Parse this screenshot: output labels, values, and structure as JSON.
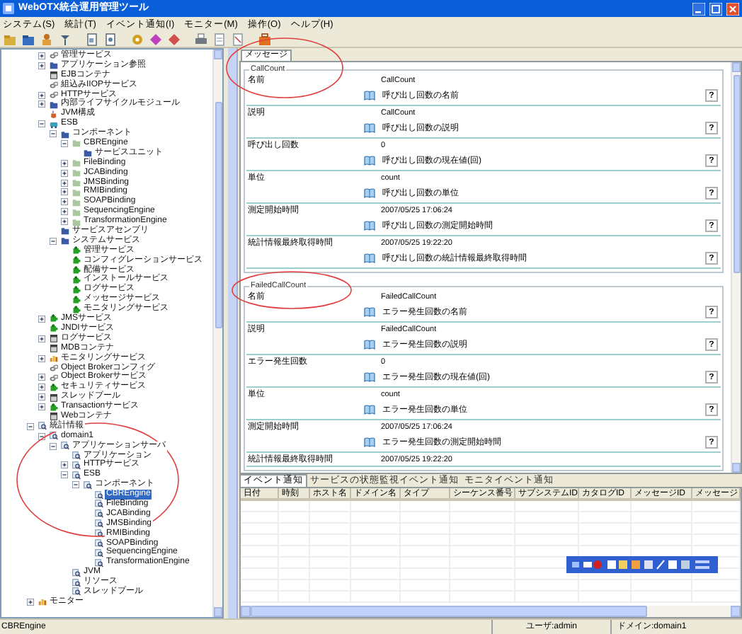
{
  "window": {
    "title": "WebOTX統合運用管理ツール"
  },
  "menu": [
    "システム(S)",
    "統計(T)",
    "イベント通知(I)",
    "モニター(M)",
    "操作(O)",
    "ヘルプ(H)"
  ],
  "tree": {
    "scrolled_branch": [
      {
        "label": "管理サービス",
        "kind": "link",
        "expanded": false,
        "selected": false
      },
      {
        "label": "アプリケーション参照",
        "kind": "folder",
        "expanded": false,
        "selected": false
      },
      {
        "label": "EJBコンテナ",
        "kind": "container",
        "selected": false
      },
      {
        "label": "組込みIIOPサービス",
        "kind": "link",
        "selected": false
      },
      {
        "label": "HTTPサービス",
        "kind": "link",
        "expanded": false,
        "selected": false
      },
      {
        "label": "内部ライフサイクルモジュール",
        "kind": "folder",
        "expanded": false,
        "selected": false
      },
      {
        "label": "JVM構成",
        "kind": "jvm",
        "selected": false
      },
      {
        "label": "ESB",
        "kind": "esb",
        "expanded": true,
        "selected": false,
        "children": [
          {
            "label": "コンポーネント",
            "kind": "folder",
            "expanded": true,
            "selected": false,
            "children": [
              {
                "label": "CBREngine",
                "kind": "leaf",
                "expanded": true,
                "selected": false,
                "children": [
                  {
                    "label": "サービスユニット",
                    "kind": "folder",
                    "selected": false
                  }
                ]
              },
              {
                "label": "FileBinding",
                "kind": "leaf",
                "expanded": false,
                "selected": false
              },
              {
                "label": "JCABinding",
                "kind": "leaf",
                "expanded": false,
                "selected": false
              },
              {
                "label": "JMSBinding",
                "kind": "leaf",
                "expanded": false,
                "selected": false
              },
              {
                "label": "RMIBinding",
                "kind": "leaf",
                "expanded": false,
                "selected": false
              },
              {
                "label": "SOAPBinding",
                "kind": "leaf",
                "expanded": false,
                "selected": false
              },
              {
                "label": "SequencingEngine",
                "kind": "leaf",
                "expanded": false,
                "selected": false
              },
              {
                "label": "TransformationEngine",
                "kind": "leaf",
                "expanded": false,
                "selected": false
              }
            ]
          },
          {
            "label": "サービスアセンブリ",
            "kind": "folder",
            "selected": false
          },
          {
            "label": "システムサービス",
            "kind": "folder",
            "expanded": true,
            "selected": false,
            "children": [
              {
                "label": "管理サービス",
                "kind": "service",
                "selected": false
              },
              {
                "label": "コンフィグレーションサービス",
                "kind": "service",
                "selected": false
              },
              {
                "label": "配備サービス",
                "kind": "service",
                "selected": false
              },
              {
                "label": "インストールサービス",
                "kind": "service",
                "selected": false
              },
              {
                "label": "ログサービス",
                "kind": "service",
                "selected": false
              },
              {
                "label": "メッセージサービス",
                "kind": "service",
                "selected": false
              },
              {
                "label": "モニタリングサービス",
                "kind": "service",
                "selected": false
              }
            ]
          }
        ]
      },
      {
        "label": "JMSサービス",
        "kind": "service",
        "expanded": false,
        "selected": false
      },
      {
        "label": "JNDIサービス",
        "kind": "service",
        "selected": false
      },
      {
        "label": "ログサービス",
        "kind": "container",
        "expanded": false,
        "selected": false
      },
      {
        "label": "MDBコンテナ",
        "kind": "container",
        "selected": false
      },
      {
        "label": "モニタリングサービス",
        "kind": "monitor",
        "expanded": false,
        "selected": false
      },
      {
        "label": "Object Brokerコンフィグ",
        "kind": "link",
        "selected": false
      },
      {
        "label": "Object Brokerサービス",
        "kind": "link",
        "expanded": false,
        "selected": false
      },
      {
        "label": "セキュリティサービス",
        "kind": "service",
        "expanded": false,
        "selected": false
      },
      {
        "label": "スレッドプール",
        "kind": "container",
        "expanded": false,
        "selected": false
      },
      {
        "label": "Transactionサービス",
        "kind": "service",
        "expanded": false,
        "selected": false
      },
      {
        "label": "Webコンテナ",
        "kind": "container",
        "selected": false
      }
    ],
    "items": [
      {
        "label": "統計情報",
        "kind": "stats",
        "expanded": true,
        "selected": false,
        "children": [
          {
            "label": "domain1",
            "kind": "stats",
            "expanded": true,
            "selected": false,
            "children": [
              {
                "label": "アプリケーションサーバ",
                "kind": "stats",
                "expanded": true,
                "selected": false,
                "children": [
                  {
                    "label": "アプリケーション",
                    "kind": "stats",
                    "selected": false
                  },
                  {
                    "label": "HTTPサービス",
                    "kind": "stats",
                    "expanded": false,
                    "selected": false
                  },
                  {
                    "label": "ESB",
                    "kind": "stats",
                    "expanded": true,
                    "selected": false,
                    "children": [
                      {
                        "label": "コンポーネント",
                        "kind": "stats",
                        "expanded": true,
                        "selected": false,
                        "children": [
                          {
                            "label": "CBREngine",
                            "kind": "stats",
                            "selected": true
                          },
                          {
                            "label": "FileBinding",
                            "kind": "stats",
                            "selected": false
                          },
                          {
                            "label": "JCABinding",
                            "kind": "stats",
                            "selected": false
                          },
                          {
                            "label": "JMSBinding",
                            "kind": "stats",
                            "selected": false
                          },
                          {
                            "label": "RMIBinding",
                            "kind": "stats",
                            "selected": false
                          },
                          {
                            "label": "SOAPBinding",
                            "kind": "stats",
                            "selected": false
                          },
                          {
                            "label": "SequencingEngine",
                            "kind": "stats",
                            "selected": false
                          },
                          {
                            "label": "TransformationEngine",
                            "kind": "stats",
                            "selected": false
                          }
                        ]
                      }
                    ]
                  },
                  {
                    "label": "JVM",
                    "kind": "stats",
                    "selected": false
                  },
                  {
                    "label": "リソース",
                    "kind": "stats",
                    "selected": false
                  },
                  {
                    "label": "スレッドプール",
                    "kind": "stats",
                    "selected": false
                  }
                ]
              }
            ]
          }
        ]
      },
      {
        "label": "モニター",
        "kind": "monitor",
        "expanded": false,
        "selected": false
      }
    ]
  },
  "tabs": [
    {
      "label": "メッセージ",
      "selected": true
    }
  ],
  "groups": [
    {
      "title": "CallCount",
      "rows": [
        {
          "label": "名前",
          "value": "CallCount",
          "description": "呼び出し回数の名前",
          "help": "?"
        },
        {
          "label": "説明",
          "value": "CallCount",
          "description": "呼び出し回数の説明",
          "help": "?"
        },
        {
          "label": "呼び出し回数",
          "value": "0",
          "description": "呼び出し回数の現在値(回)",
          "help": "?"
        },
        {
          "label": "単位",
          "value": "count",
          "description": "呼び出し回数の単位",
          "help": "?"
        },
        {
          "label": "測定開始時間",
          "value": "2007/05/25 17:06:24",
          "description": "呼び出し回数の測定開始時間",
          "help": "?"
        },
        {
          "label": "統計情報最終取得時間",
          "value": "2007/05/25 19:22:20",
          "description": "呼び出し回数の統計情報最終取得時間",
          "help": "?"
        }
      ]
    },
    {
      "title": "FailedCallCount",
      "rows": [
        {
          "label": "名前",
          "value": "FailedCallCount",
          "description": "エラー発生回数の名前",
          "help": "?"
        },
        {
          "label": "説明",
          "value": "FailedCallCount",
          "description": "エラー発生回数の説明",
          "help": "?"
        },
        {
          "label": "エラー発生回数",
          "value": "0",
          "description": "エラー発生回数の現在値(回)",
          "help": "?"
        },
        {
          "label": "単位",
          "value": "count",
          "description": "エラー発生回数の単位",
          "help": "?"
        },
        {
          "label": "測定開始時間",
          "value": "2007/05/25 17:06:24",
          "description": "エラー発生回数の測定開始時間",
          "help": "?"
        },
        {
          "label": "統計情報最終取得時間",
          "value": "2007/05/25 19:22:20"
        }
      ]
    }
  ],
  "event_tabs": [
    {
      "label": "イベント通知",
      "selected": true
    },
    {
      "label": "サービスの状態監視イベント通知",
      "selected": false
    },
    {
      "label": "モニタイベント通知",
      "selected": false
    }
  ],
  "event_table": {
    "columns": [
      "日付",
      "時刻",
      "ホスト名",
      "ドメイン名",
      "タイプ",
      "シーケンス番号",
      "サブシステムID",
      "カタログID",
      "メッセージID",
      "メッセージ"
    ]
  },
  "status_bar": {
    "selection": "CBREngine",
    "user": "ユーザ:admin",
    "domain": "ドメイン:domain1"
  }
}
